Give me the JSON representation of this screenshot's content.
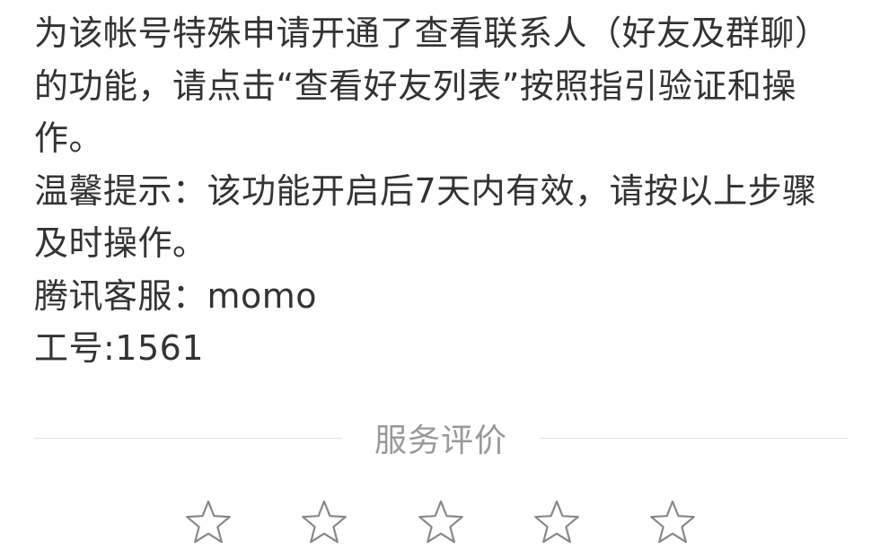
{
  "message": {
    "line1": "为该帐号特殊申请开通了查看联系人（好友及群聊）的功能，请点击“查看好友列表”按照指引验证和操作。",
    "line2": "温馨提示：该功能开启后7天内有效，请按以上步骤及时操作。",
    "line3": "腾讯客服：momo",
    "line4": "工号:1561"
  },
  "rating": {
    "label": "服务评价",
    "star_count": 5,
    "selected": 0,
    "star_icon": "star-outline-icon",
    "colors": {
      "star_stroke": "#888888",
      "divider": "#e2e2e2",
      "label": "#999999",
      "text": "#333333"
    }
  }
}
